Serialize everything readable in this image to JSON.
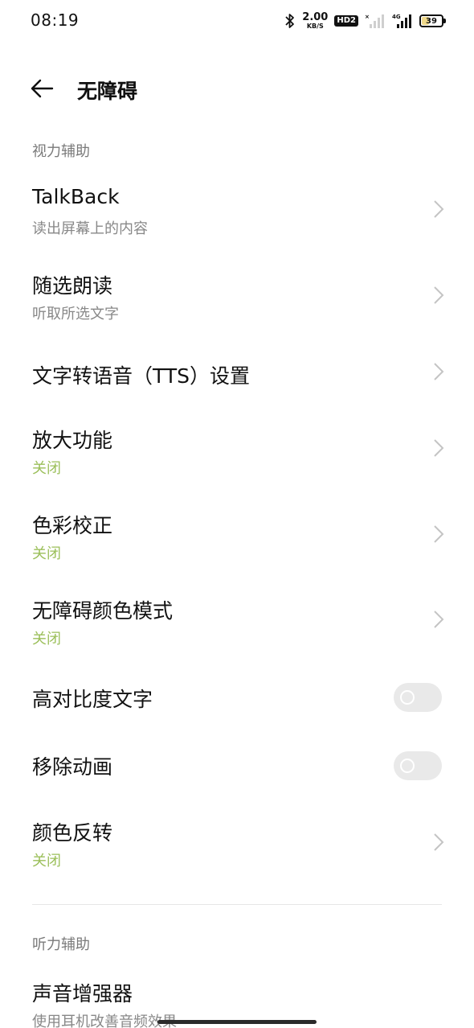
{
  "status_bar": {
    "time": "08:19",
    "net_speed_value": "2.00",
    "net_speed_unit": "KB/S",
    "hd_label": "HD2",
    "lte_label": "4G",
    "battery": "39",
    "battery_level_percent": 39,
    "battery_fill_color": "#f0d98a"
  },
  "header": {
    "title": "无障碍"
  },
  "sections": [
    {
      "title": "视力辅助",
      "items": [
        {
          "title": "TalkBack",
          "subtitle": "读出屏幕上的内容",
          "control": "chevron"
        },
        {
          "title": "随选朗读",
          "subtitle": "听取所选文字",
          "control": "chevron"
        },
        {
          "title": "文字转语音（TTS）设置",
          "control": "chevron"
        },
        {
          "title": "放大功能",
          "status": "关闭",
          "control": "chevron"
        },
        {
          "title": "色彩校正",
          "status": "关闭",
          "control": "chevron"
        },
        {
          "title": "无障碍颜色模式",
          "status": "关闭",
          "control": "chevron"
        },
        {
          "title": "高对比度文字",
          "control": "toggle",
          "toggle_on": false
        },
        {
          "title": "移除动画",
          "control": "toggle",
          "toggle_on": false
        },
        {
          "title": "颜色反转",
          "status": "关闭",
          "control": "chevron"
        }
      ]
    },
    {
      "title": "听力辅助",
      "items": [
        {
          "title": "声音增强器",
          "subtitle": "使用耳机改善音频效果"
        }
      ]
    }
  ],
  "colors": {
    "status_green": "#9bbf5a",
    "toggle_off_bg": "#e9e9e9",
    "section_gray": "#7a7a7a"
  },
  "icons": [
    "back-arrow-icon",
    "chevron-right-icon",
    "bluetooth-icon",
    "signal-icon"
  ]
}
